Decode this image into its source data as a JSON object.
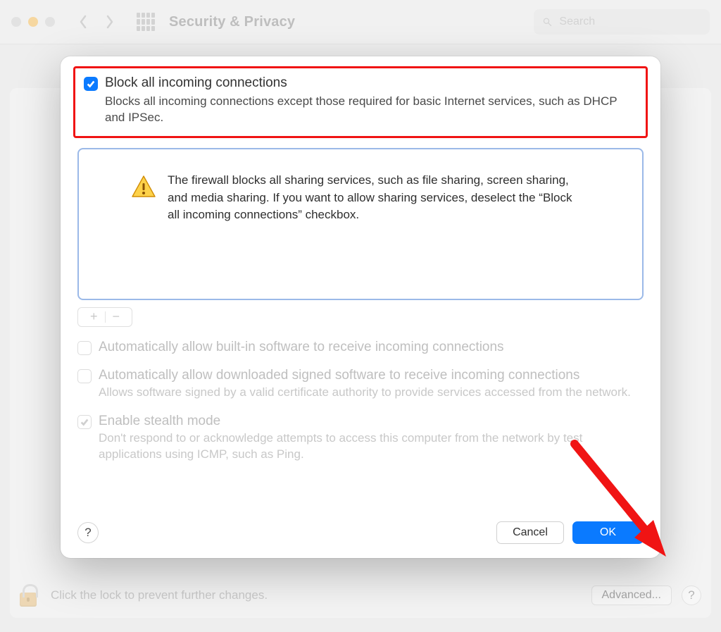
{
  "toolbar": {
    "title": "Security & Privacy",
    "search_placeholder": "Search"
  },
  "background": {
    "lock_text": "Click the lock to prevent further changes.",
    "advanced_label": "Advanced...",
    "help_label": "?"
  },
  "modal": {
    "block_all": {
      "title": "Block all incoming connections",
      "desc": "Blocks all incoming connections except those required for basic Internet services, such as DHCP and IPSec.",
      "checked": true
    },
    "warning": "The firewall blocks all sharing services, such as file sharing, screen sharing, and media sharing. If you want to allow sharing services, deselect the “Block all incoming connections” checkbox.",
    "pm_plus": "+",
    "pm_minus": "−",
    "builtin": {
      "title": "Automatically allow built-in software to receive incoming connections",
      "checked": false
    },
    "signed": {
      "title": "Automatically allow downloaded signed software to receive incoming connections",
      "desc": "Allows software signed by a valid certificate authority to provide services accessed from the network.",
      "checked": false
    },
    "stealth": {
      "title": "Enable stealth mode",
      "desc": "Don't respond to or acknowledge attempts to access this computer from the network by test applications using ICMP, such as Ping.",
      "checked": true
    },
    "footer": {
      "help": "?",
      "cancel": "Cancel",
      "ok": "OK"
    }
  }
}
